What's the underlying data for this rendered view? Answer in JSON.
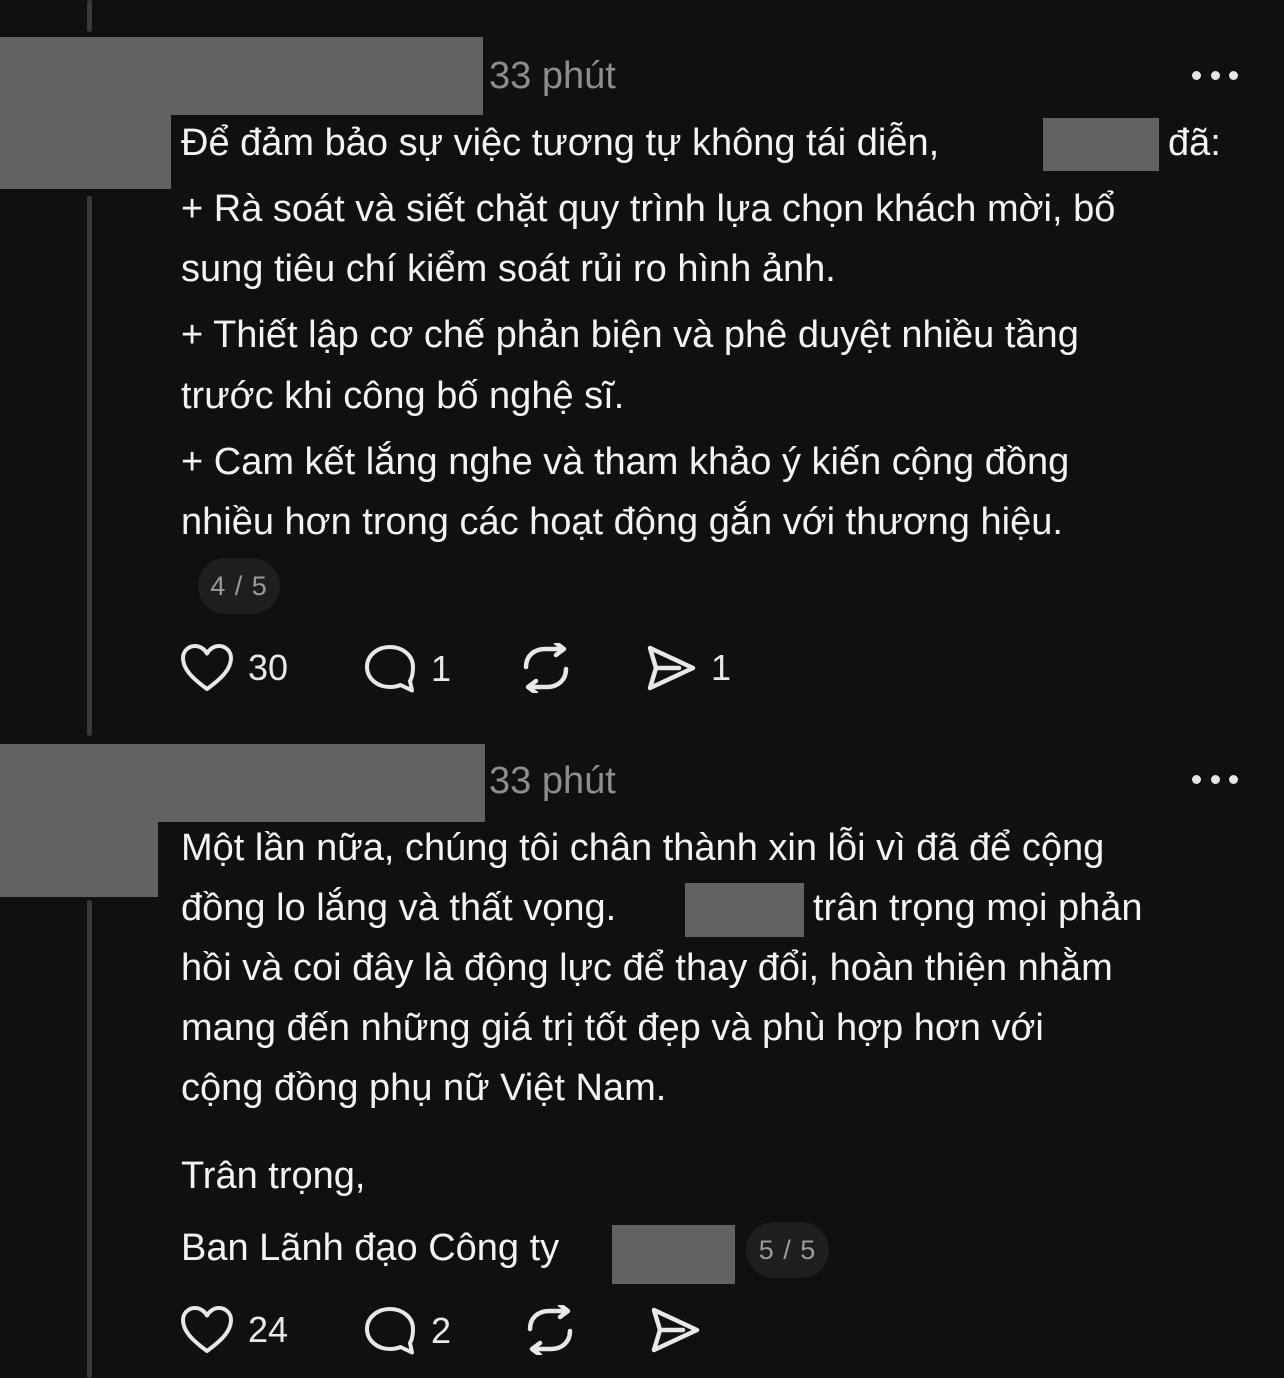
{
  "posts": [
    {
      "time": "33 phút",
      "lines": [
        {
          "a": "Để đảm bảo sự việc tương tự không tái diễn,",
          "b": "đã:"
        },
        {
          "a": "+ Rà soát và siết chặt quy trình lựa chọn khách mời, bổ"
        },
        {
          "a": "sung tiêu chí kiểm soát rủi ro hình ảnh."
        },
        {
          "a": "+ Thiết lập cơ chế phản biện và phê duyệt nhiều tầng"
        },
        {
          "a": "trước khi công bố nghệ sĩ."
        },
        {
          "a": "+ Cam kết lắng nghe và tham khảo ý kiến cộng đồng"
        },
        {
          "a": "nhiều hơn trong các hoạt động gắn với thương hiệu."
        }
      ],
      "page_indicator": "4 / 5",
      "actions": {
        "likes": "30",
        "replies": "1",
        "reposts": "",
        "shares": "1"
      }
    },
    {
      "time": "33 phút",
      "lines": [
        {
          "a": "Một lần nữa, chúng tôi chân thành xin lỗi vì đã để cộng"
        },
        {
          "a": "đồng lo lắng và thất vọng.",
          "b": "trân trọng mọi phản"
        },
        {
          "a": "hồi và coi đây là động lực để thay đổi, hoàn thiện nhằm"
        },
        {
          "a": "mang đến những giá trị tốt đẹp và phù hợp hơn với"
        },
        {
          "a": "cộng đồng phụ nữ Việt Nam."
        },
        {
          "a": "Trân trọng,"
        },
        {
          "a": "Ban Lãnh đạo Công ty"
        }
      ],
      "page_indicator": "5 / 5",
      "actions": {
        "likes": "24",
        "replies": "2",
        "reposts": "",
        "shares": ""
      }
    }
  ],
  "colors": {
    "background": "#101010",
    "text": "#f3f3f3",
    "muted": "#8d8d8d",
    "redaction": "#626262",
    "thread_line": "#3a3a3a"
  },
  "icons": {
    "more": "more-horizontal-icon",
    "like": "heart-icon",
    "reply": "speech-bubble-icon",
    "repost": "repost-icon",
    "share": "send-icon"
  }
}
